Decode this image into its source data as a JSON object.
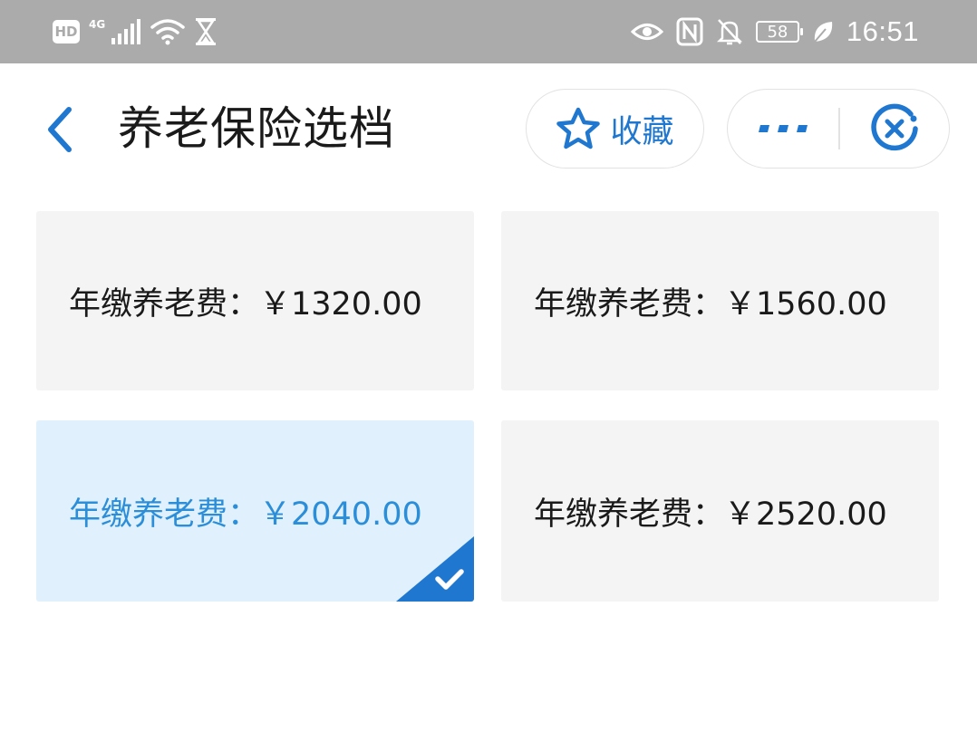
{
  "status_bar": {
    "hd_badge": "HD",
    "network": "4G",
    "battery_level": "58",
    "time": "16:51",
    "icons": [
      "hd-icon",
      "signal-icon",
      "wifi-icon",
      "hourglass-icon",
      "eye-icon",
      "nfc-icon",
      "bell-off-icon",
      "battery-icon",
      "leaf-icon"
    ]
  },
  "header": {
    "back_icon": "chevron-left-icon",
    "title": "养老保险选档",
    "favorite_label": "收藏",
    "favorite_icon": "star-icon",
    "more_icon": "more-dots-icon",
    "close_icon": "close-circle-icon"
  },
  "options": [
    {
      "label": "年缴养老费：￥1320.00",
      "selected": false
    },
    {
      "label": "年缴养老费：￥1560.00",
      "selected": false
    },
    {
      "label": "年缴养老费：￥2040.00",
      "selected": true
    },
    {
      "label": "年缴养老费：￥2520.00",
      "selected": false
    }
  ],
  "colors": {
    "accent": "#1f77d0",
    "selected_bg": "#e1f0fd",
    "selected_text": "#2b8ed8",
    "card_bg": "#f4f4f4",
    "status_bar_bg": "#ababab"
  }
}
